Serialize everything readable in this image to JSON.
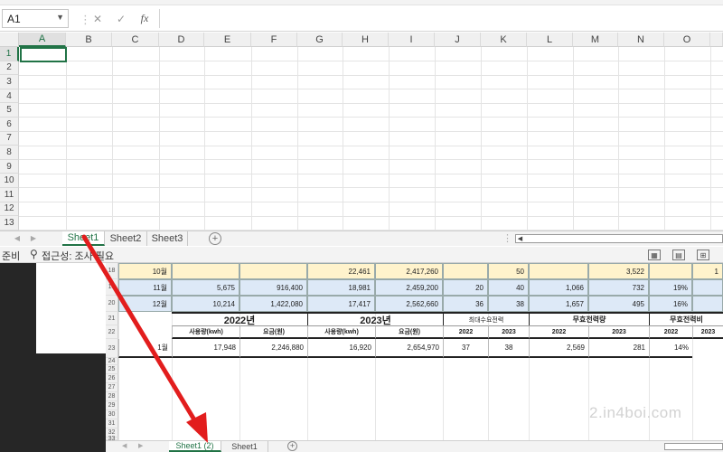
{
  "namebox": {
    "value": "A1"
  },
  "formula_bar": {
    "cancel_icon": "✕",
    "enter_icon": "✓",
    "fx_label": "fx",
    "value": ""
  },
  "grid": {
    "columns": [
      "A",
      "B",
      "C",
      "D",
      "E",
      "F",
      "G",
      "H",
      "I",
      "J",
      "K",
      "L",
      "M",
      "N",
      "O"
    ],
    "rows": [
      "1",
      "2",
      "3",
      "4",
      "5",
      "6",
      "7",
      "8",
      "9",
      "10",
      "11",
      "12",
      "13"
    ],
    "selected_cell": "A1"
  },
  "tabs": {
    "sheets": [
      "Sheet1",
      "Sheet2",
      "Sheet3"
    ],
    "active": "Sheet1",
    "add_icon": "+"
  },
  "status": {
    "ready": "준비",
    "accessibility": "접근성: 조사 필요"
  },
  "preview": {
    "row_numbers": [
      "18",
      "19",
      "20",
      "21",
      "22",
      "23",
      "24",
      "25",
      "26",
      "27",
      "28",
      "29",
      "30",
      "31",
      "32",
      "33"
    ],
    "rows": [
      {
        "month": "10월",
        "e": "",
        "f": "",
        "g": "22,461",
        "h": "2,417,260",
        "i": "",
        "j": "50",
        "k": "",
        "l": "3,522",
        "m": "",
        "n": "1"
      },
      {
        "month": "11월",
        "e": "5,675",
        "f": "916,400",
        "g": "18,981",
        "h": "2,459,200",
        "i": "20",
        "j": "40",
        "k": "1,066",
        "l": "732",
        "m": "19%",
        "n": ""
      },
      {
        "month": "12월",
        "e": "10,214",
        "f": "1,422,080",
        "g": "17,417",
        "h": "2,562,660",
        "i": "36",
        "j": "38",
        "k": "1,657",
        "l": "495",
        "m": "16%",
        "n": ""
      }
    ],
    "header_2022": "2022년",
    "header_2023": "2023년",
    "header_peak": "최대수요전력",
    "header_reactive": "무효전력량",
    "header_reactive_rate": "무효전력비",
    "sub_usage": "사용량(kwh)",
    "sub_fee": "요금(원)",
    "sub_y2022": "2022",
    "sub_y2023": "2023",
    "data_row": {
      "month": "1월",
      "e": "17,948",
      "f": "2,246,880",
      "g": "16,920",
      "h": "2,654,970",
      "i": "37",
      "j": "38",
      "k": "2,569",
      "l": "281",
      "m": "14%"
    },
    "tabs": [
      "Sheet1 (2)",
      "Sheet1"
    ],
    "active_tab": "Sheet1 (2)",
    "add_icon": "+"
  },
  "watermark": "2.in4boi.com",
  "colors": {
    "accent": "#217346",
    "arrow": "#e21d1d",
    "row_tint_yellow": "#fff3cc",
    "row_tint_blue": "#dde9f7"
  }
}
